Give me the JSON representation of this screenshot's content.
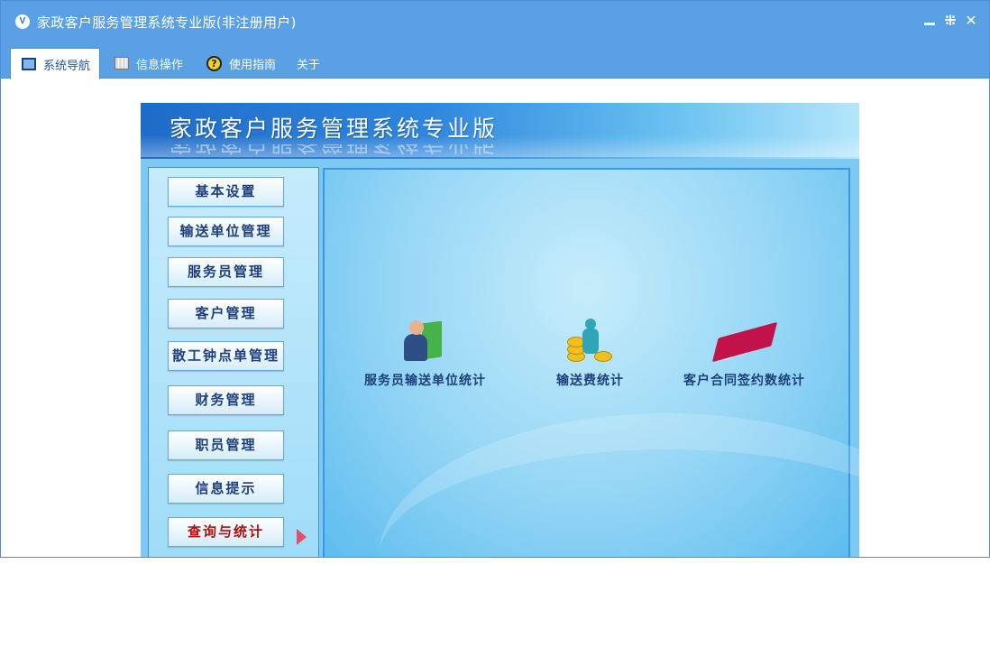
{
  "window": {
    "title": "家政客户服务管理系统专业版(非注册用户)",
    "logo_text": "V"
  },
  "menu": {
    "tabs": [
      {
        "label": "系统导航",
        "icon": "monitor-icon",
        "active": true
      },
      {
        "label": "信息操作",
        "icon": "grid-icon",
        "active": false
      },
      {
        "label": "使用指南",
        "icon": "help-icon",
        "active": false
      },
      {
        "label": "关于",
        "icon": "",
        "active": false
      }
    ]
  },
  "banner": {
    "title": "家政客户服务管理系统专业版"
  },
  "nav": {
    "items": [
      {
        "label": "基本设置"
      },
      {
        "label": "输送单位管理"
      },
      {
        "label": "服务员管理"
      },
      {
        "label": "客户管理"
      },
      {
        "label": "散工钟点单管理"
      },
      {
        "label": "财务管理"
      },
      {
        "label": "职员管理"
      },
      {
        "label": "信息提示"
      },
      {
        "label": "查询与统计",
        "active": true
      }
    ]
  },
  "functions": [
    {
      "label": "服务员输送单位统计",
      "icon": "person-book-icon"
    },
    {
      "label": "输送费统计",
      "icon": "coins-person-icon"
    },
    {
      "label": "客户合同签约数统计",
      "icon": "red-book-icon"
    }
  ],
  "colors": {
    "title_bar": "#5aa0e4",
    "nav_text": "#1d3f7a",
    "active_nav_text": "#b01010",
    "panel_bg": "#93d5f5"
  }
}
